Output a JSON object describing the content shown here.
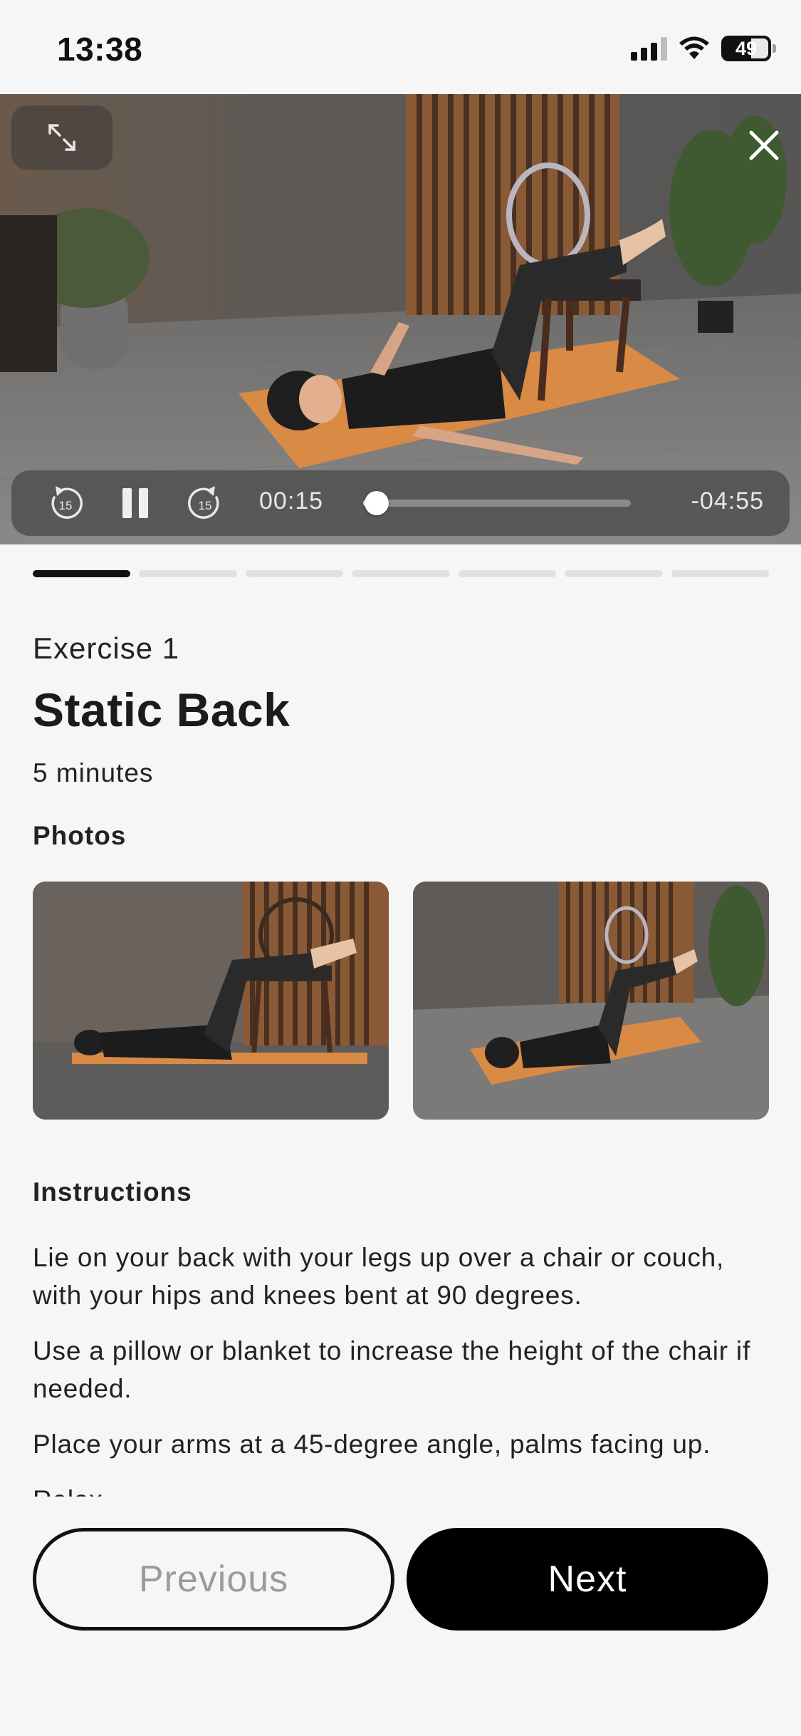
{
  "status_bar": {
    "time": "13:38",
    "battery": "49",
    "icons": [
      "signal-icon",
      "wifi-icon",
      "battery-icon"
    ]
  },
  "video": {
    "elapsed": "00:15",
    "remaining": "-04:55",
    "progress_fraction": 0.05,
    "skip_back_seconds": "15",
    "skip_forward_seconds": "15",
    "icons": [
      "expand-icon",
      "close-icon",
      "skip-back-icon",
      "pause-icon",
      "skip-forward-icon"
    ]
  },
  "segments": {
    "total": 7,
    "active_index": 0
  },
  "exercise": {
    "label": "Exercise 1",
    "title": "Static Back",
    "duration": "5 minutes"
  },
  "photos": {
    "heading": "Photos"
  },
  "instructions": {
    "heading": "Instructions",
    "paragraphs": [
      "Lie on your back with your legs up over a chair or couch, with your hips and knees bent at 90 degrees.",
      "Use a pillow or blanket to increase the height of the chair if needed.",
      "Place your arms at a 45-degree angle, palms facing up.",
      "Relax"
    ]
  },
  "buttons": {
    "previous": "Previous",
    "next": "Next"
  },
  "colors": {
    "background": "#f6f6f6",
    "accent": "#000000",
    "mat": "#d98a45"
  }
}
